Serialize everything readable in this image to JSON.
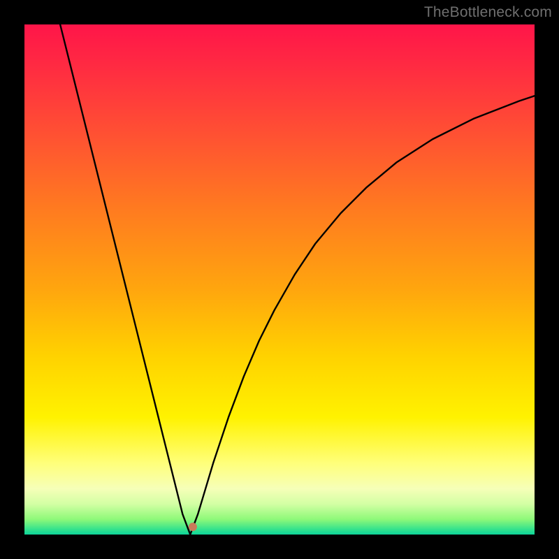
{
  "watermark": "TheBottleneck.com",
  "chart_data": {
    "type": "line",
    "title": "",
    "xlabel": "",
    "ylabel": "",
    "xlim": [
      0,
      100
    ],
    "ylim": [
      0,
      100
    ],
    "series": [
      {
        "name": "bottleneck-curve",
        "x": [
          7,
          10,
          13,
          16,
          19,
          22,
          25,
          28,
          31,
          32.5,
          34,
          37,
          40,
          43,
          46,
          49,
          53,
          57,
          62,
          67,
          73,
          80,
          88,
          97,
          100
        ],
        "values": [
          100,
          88,
          76,
          64,
          52,
          40,
          28,
          16,
          4,
          0,
          4,
          14,
          23,
          31,
          38,
          44,
          51,
          57,
          63,
          68,
          73,
          77.5,
          81.5,
          85,
          86
        ]
      }
    ],
    "marker": {
      "x": 33,
      "y": 1.5,
      "color": "#c97a5a",
      "radius_px": 6
    },
    "gradient_stops": [
      {
        "pos": 0,
        "color": "#ff1549"
      },
      {
        "pos": 22,
        "color": "#ff5232"
      },
      {
        "pos": 52,
        "color": "#ffa60e"
      },
      {
        "pos": 77,
        "color": "#fff200"
      },
      {
        "pos": 94,
        "color": "#d3ffa4"
      },
      {
        "pos": 100,
        "color": "#0dd49a"
      }
    ]
  }
}
